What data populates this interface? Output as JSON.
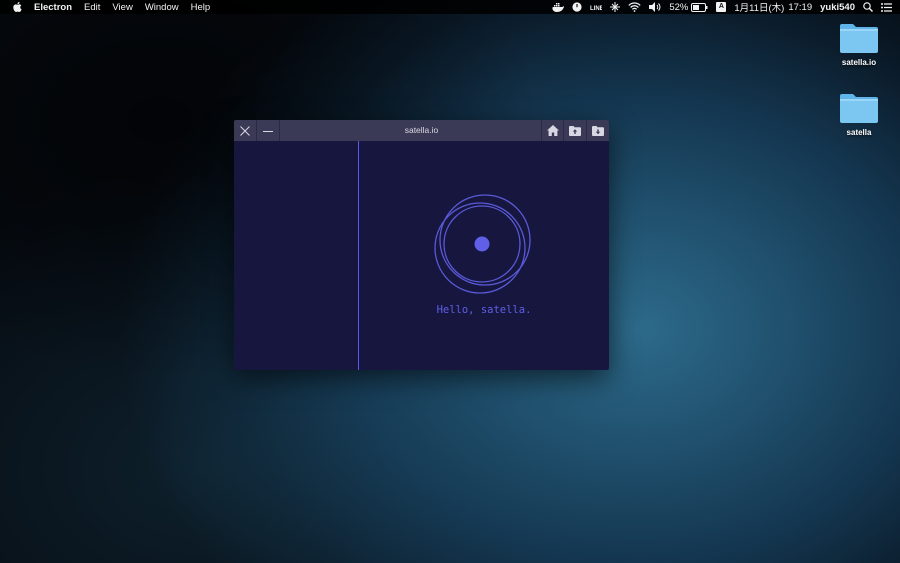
{
  "menubar": {
    "app_name": "Electron",
    "items": [
      "Edit",
      "View",
      "Window",
      "Help"
    ],
    "tray": {
      "battery": "52%",
      "input_source": "A",
      "date": "1月11日(木)",
      "time": "17:19",
      "user": "yuki540",
      "icons": [
        "docker-icon",
        "status-circle-icon",
        "line-icon",
        "network-icon",
        "wifi-icon",
        "volume-icon",
        "battery-icon",
        "search-icon",
        "list-icon"
      ]
    }
  },
  "desktop": {
    "icons": [
      {
        "label": "satella.io",
        "icon": "folder-icon"
      },
      {
        "label": "satella",
        "icon": "folder-icon"
      }
    ]
  },
  "window": {
    "title": "satella.io",
    "buttons": [
      "close-icon",
      "minimize-icon",
      "home-icon",
      "folder-upload-icon",
      "folder-download-icon"
    ],
    "greeting": "Hello, satella."
  },
  "colors": {
    "window_bg": "#16163f",
    "titlebar_bg": "#3a3a56",
    "accent": "#5f5fe8"
  }
}
